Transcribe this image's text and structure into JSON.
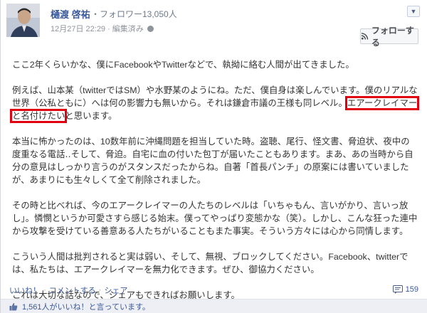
{
  "author": {
    "name": "樋渡 啓祐",
    "followers": "・フォロワー13,050人",
    "date": "12月27日 22:29",
    "edit_history": "編集済み"
  },
  "follow_button": {
    "label": "フォローする"
  },
  "post": {
    "p1": "ここ2年くらいかな、僕にFacebookやTwitterなどで、執拗に絡む人間が出てきました。",
    "p2_pre": "例えば、山本某（twitterではSM）や水野某のようにね。ただ、僕自身は楽しんでいます。僕のリアルな世界（公私ともに）へは何の影響力も無いから。それは鎌倉市議の王様も同レベル。",
    "p2_highlight": "エアークレイマーと名付けたい",
    "p2_post": "と思います。",
    "p3": "本当に怖かったのは、10数年前に沖縄問題を担当していた時。盗聴、尾行、怪文書、脅迫状、夜中の度重なる電話‥そして、脅迫。自宅に血の付いた包丁が届いたこともあります。まあ、あの当時から自分の意見はしっかり言うのがスタンスだったからね。自著「首長パンチ」の原案には書いていましたが、あまりにも生々しくて全て削除されました。",
    "p4": "その時と比べれば、今のエアークレイマーの人たちのレベルは「いちゃもん、言いがかり、言いっ放し」。憐憫というか可愛さすら感じる始末。僕ってやっぱり変態かな（笑）。しかし、こんな狂った連中から攻撃を受けている善意ある人たちがいることもまた事実。そういう方々には心から同情します。",
    "p5": "こういう人間は批判されると実は弱い、そして、無視、ブロックしてください。Facebook、twitterでは、私たちは、エアークレイマーを無力化できます。ぜひ、御協力ください。",
    "p6": "これは大切な話なので、シェアもできればお願いします。"
  },
  "actions": {
    "like": "いいね！",
    "comment": "コメントする",
    "share": "シェア",
    "comment_count": "159"
  },
  "likes": {
    "text": "1,561人がいいね！と言っています。"
  },
  "colors": {
    "link": "#3b5998",
    "highlight": "#e00010"
  }
}
